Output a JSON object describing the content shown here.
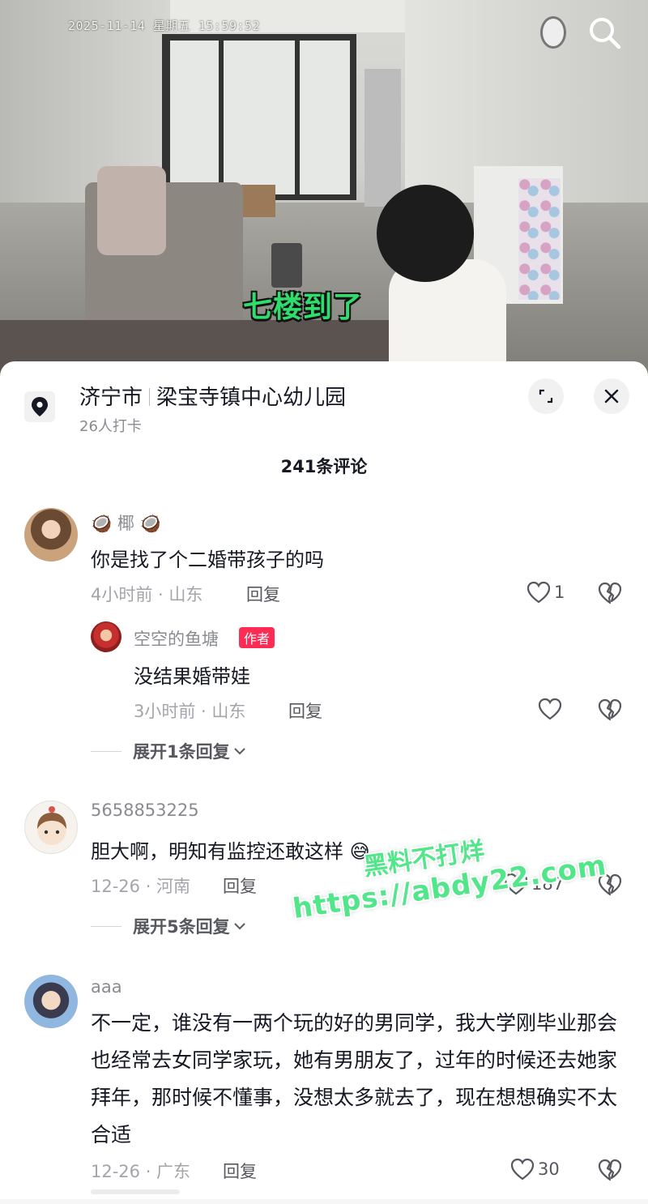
{
  "video": {
    "camera_timestamp": "2025-11-14  星期五  15:59:52",
    "caption": "七楼到了"
  },
  "location": {
    "city": "济宁市",
    "place": "梁宝寺镇中心幼儿园",
    "checkins": "26人打卡"
  },
  "comments_header": {
    "count_label": "241条评论"
  },
  "comments": [
    {
      "username": "🥥 椰 🥥",
      "text": "你是找了个二婚带孩子的吗",
      "meta": "4小时前 · 山东",
      "reply_label": "回复",
      "likes": "1",
      "replies": [
        {
          "username": "空空的鱼塘",
          "tag": "作者",
          "text": "没结果婚带娃",
          "meta": "3小时前 · 山东",
          "reply_label": "回复"
        }
      ],
      "expand_label": "展开1条回复"
    },
    {
      "username": "5658853225",
      "text": "胆大啊，明知有监控还敢这样 😅",
      "meta": "12-26 · 河南",
      "reply_label": "回复",
      "likes": "187",
      "expand_label": "展开5条回复"
    },
    {
      "username": "aaa",
      "text": "不一定，谁没有一两个玩的好的男同学，我大学刚毕业那会也经常去女同学家玩，她有男朋友了，过年的时候还去她家拜年，那时候不懂事，没想太多就去了，现在想想确实不太合适",
      "meta": "12-26 · 广东",
      "reply_label": "回复",
      "likes": "30"
    }
  ],
  "watermark": {
    "line1": "黑料不打烊",
    "line2": "https://abdy22.com"
  },
  "icons": {
    "search": "search-icon",
    "location": "location-pin-icon",
    "expand": "expand-icon",
    "close": "close-icon",
    "like": "heart-icon",
    "dislike": "broken-heart-icon",
    "chevron": "chevron-down-icon"
  },
  "colors": {
    "caption_green": "#2fdd6d",
    "author_tag": "#fe2c55",
    "watermark_green": "#52e68a"
  }
}
